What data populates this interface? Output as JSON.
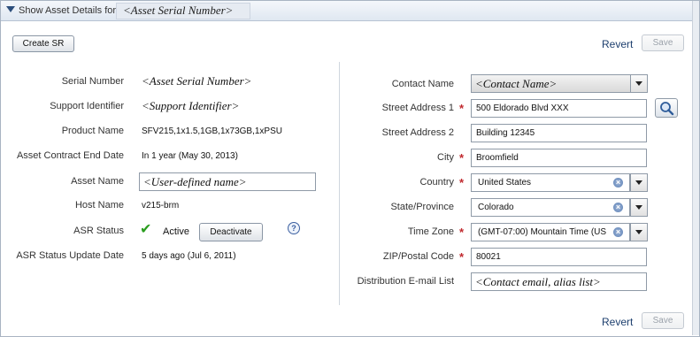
{
  "header": {
    "title": "Show Asset Details for",
    "asset_placeholder": "<Asset Serial Number>"
  },
  "toolbar": {
    "create_sr_label": "Create SR",
    "revert_label": "Revert",
    "save_label": "Save"
  },
  "left": {
    "serial_number": {
      "label": "Serial Number",
      "value": "<Asset Serial Number>"
    },
    "support_identifier": {
      "label": "Support Identifier",
      "value": "<Support Identifier>"
    },
    "product_name": {
      "label": "Product Name",
      "value": "SFV215,1x1.5,1GB,1x73GB,1xPSU"
    },
    "contract_end": {
      "label": "Asset Contract End Date",
      "value": "In 1 year (May 30, 2013)"
    },
    "asset_name": {
      "label": "Asset Name",
      "value": "<User-defined name>"
    },
    "host_name": {
      "label": "Host Name",
      "value": "v215-brm"
    },
    "asr_status": {
      "label": "ASR Status",
      "value": "Active",
      "button": "Deactivate",
      "help_glyph": "?"
    },
    "asr_update": {
      "label": "ASR Status Update Date",
      "value": "5 days ago (Jul 6, 2011)"
    }
  },
  "right": {
    "contact_name": {
      "label": "Contact Name",
      "value": "<Contact Name>"
    },
    "street1": {
      "label": "Street Address 1",
      "value": "500 Eldorado Blvd  XXX"
    },
    "street2": {
      "label": "Street Address 2",
      "value": "Building 12345"
    },
    "city": {
      "label": "City",
      "value": "Broomfield"
    },
    "country": {
      "label": "Country",
      "value": "United States"
    },
    "state": {
      "label": "State/Province",
      "value": "Colorado"
    },
    "timezone": {
      "label": "Time Zone",
      "value": "(GMT-07:00) Mountain Time (US"
    },
    "zip": {
      "label": "ZIP/Postal Code",
      "value": "80021"
    },
    "email_list": {
      "label": "Distribution E-mail List",
      "value": "<Contact email, alias list>"
    }
  },
  "required_marker": "*",
  "clear_glyph": "×",
  "footer": {
    "revert_label": "Revert",
    "save_label": "Save"
  }
}
